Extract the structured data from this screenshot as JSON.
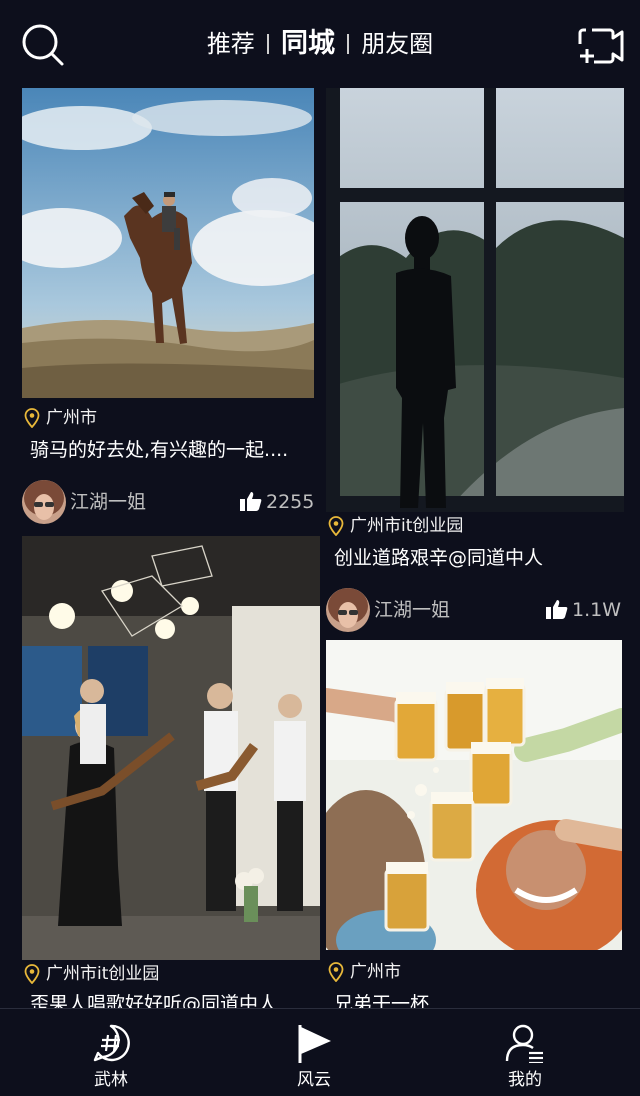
{
  "header": {
    "tabs": [
      {
        "label": "推荐",
        "active": false
      },
      {
        "label": "同城",
        "active": true
      },
      {
        "label": "朋友圈",
        "active": false
      }
    ],
    "search_icon": "search-icon",
    "camera_icon": "video-add-icon"
  },
  "feed": {
    "cards": [
      {
        "location": "广州市",
        "caption": "骑马的好去处,有兴趣的一起....",
        "author": "江湖一姐",
        "likes": "2255",
        "photo": "horse-rider-photo"
      },
      {
        "location": "广州市it创业园",
        "caption": "创业道路艰辛@同道中人",
        "author": "江湖一姐",
        "likes": "1.1W",
        "photo": "window-silhouette-photo"
      },
      {
        "location": "广州市it创业园",
        "caption": "歪果人唱歌好好听@同道中人",
        "photo": "band-singing-photo"
      },
      {
        "location": "广州市",
        "caption": "兄弟干一杯",
        "photo": "beer-toast-photo"
      }
    ]
  },
  "nav": {
    "items": [
      {
        "label": "武林",
        "icon": "hashtag-icon"
      },
      {
        "label": "风云",
        "icon": "flag-icon"
      },
      {
        "label": "我的",
        "icon": "profile-icon"
      }
    ]
  },
  "colors": {
    "background": "#0d0f1c",
    "accent": "#e8b83a",
    "text": "#ffffff",
    "muted": "#bfbfbf"
  }
}
